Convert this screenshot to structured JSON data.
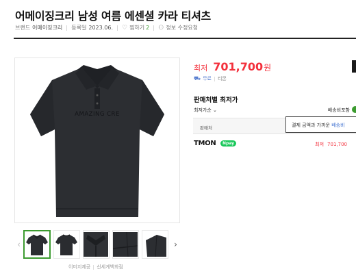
{
  "product": {
    "title": "어메이징크리 남성 여름 에센셜 카라 티셔츠"
  },
  "meta": {
    "brand_label": "브랜드",
    "brand_value": "어메이징크리",
    "registered_label": "등록일",
    "registered_value": "2023.06.",
    "wish_label": "찜하기",
    "wish_count": "2",
    "info_fix_label": "정보 수정요청"
  },
  "price": {
    "label": "최저",
    "value": "701,700",
    "unit": "원"
  },
  "shipping": {
    "free_label": "무료",
    "mall_name": "티몬"
  },
  "lowest": {
    "title": "판매처별 최저가",
    "sort_label": "최저가순",
    "shipping_included_label": "배송비포함",
    "table_header_seller": "판매처"
  },
  "tooltip": {
    "prefix": "결제 금액과 가까운 ",
    "highlight": "배송비"
  },
  "mall": {
    "name": "TMON",
    "pay_badge": "Npay",
    "price_label": "최저",
    "price_value": "701,700"
  },
  "image": {
    "print_text": "AMAZING CRE",
    "thumb_count": 5,
    "footer_left": "이미지제공",
    "footer_right": "신세계백화점"
  },
  "colors": {
    "accent_red": "#f3303c",
    "accent_green": "#3c9b2f",
    "npay_green": "#19c85a",
    "shirt": "#2c2e32"
  }
}
